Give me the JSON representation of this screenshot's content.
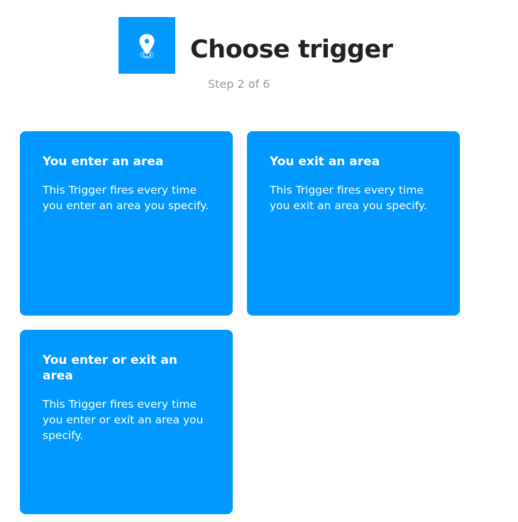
{
  "header": {
    "icon": "location-pin-icon",
    "title": "Choose trigger",
    "step": "Step 2 of 6"
  },
  "colors": {
    "accent": "#0099ff",
    "title": "#222222",
    "step": "#999999"
  },
  "triggers": [
    {
      "title": "You enter an area",
      "description": "This Trigger fires every time you enter an area you specify."
    },
    {
      "title": "You exit an area",
      "description": "This Trigger fires every time you exit an area you specify."
    },
    {
      "title": "You enter or exit an area",
      "description": "This Trigger fires every time you enter or exit an area you specify."
    }
  ]
}
